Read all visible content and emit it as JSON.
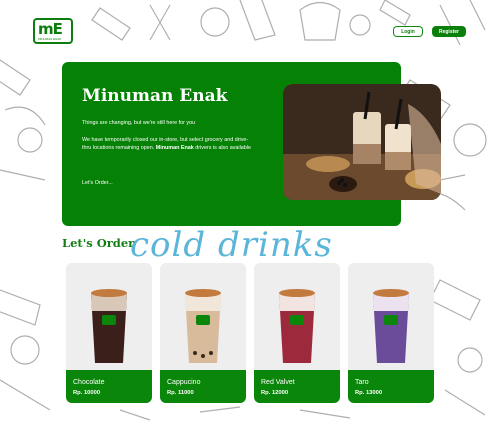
{
  "brand": {
    "logo_mark": "mE",
    "logo_sub": "MINUMAN ENAK",
    "green": "#058205",
    "accent_blue": "#5bb5d8"
  },
  "header": {
    "login_label": "Login",
    "register_label": "Register"
  },
  "hero": {
    "title": "Minuman Enak",
    "p1": "Things are changing, but we're still here for you",
    "p2_text": "We have temporarily closed our in-store, but select grocery and drive-thru locations remaining open.",
    "p2_brand": "Minuman Enak",
    "p2_tail": "drivers is also available",
    "link_label": "Let's Order..."
  },
  "menu": {
    "title": "Let's Order",
    "decor_word": "cold drinks",
    "items": [
      {
        "name": "Chocolate",
        "price": "Rp. 10000",
        "tint": "#3a1f1a"
      },
      {
        "name": "Cappucino",
        "price": "Rp. 11000",
        "tint": "#c9a986"
      },
      {
        "name": "Red Valvet",
        "price": "Rp. 12000",
        "tint": "#9c2a3c"
      },
      {
        "name": "Taro",
        "price": "Rp. 13000",
        "tint": "#6a4c9a"
      }
    ]
  }
}
